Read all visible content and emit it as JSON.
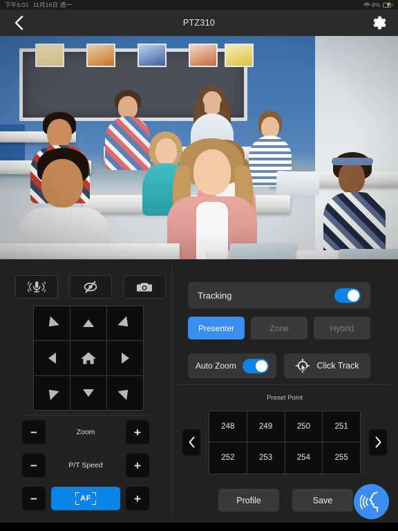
{
  "statusbar": {
    "time": "下午5:01",
    "date": "11月16日 週一",
    "wifi_icon": "wifi-icon",
    "battery_percent": "8%",
    "battery_icon": "battery-charging-icon"
  },
  "navbar": {
    "back_icon": "chevron-left-icon",
    "title": "PTZ310",
    "settings_icon": "gear-icon"
  },
  "video": {
    "alt": "classroom-live-preview"
  },
  "left_controls": {
    "icons": [
      {
        "name": "microphone-icon",
        "label": "Audio"
      },
      {
        "name": "eye-slash-icon",
        "label": "Privacy"
      },
      {
        "name": "camera-icon",
        "label": "Snapshot"
      }
    ],
    "dpad": [
      {
        "name": "pan-up-left",
        "icon": "triangle-up-left-icon"
      },
      {
        "name": "pan-up",
        "icon": "triangle-up-icon"
      },
      {
        "name": "pan-up-right",
        "icon": "triangle-up-right-icon"
      },
      {
        "name": "pan-left",
        "icon": "triangle-left-icon"
      },
      {
        "name": "home",
        "icon": "home-icon"
      },
      {
        "name": "pan-right",
        "icon": "triangle-right-icon"
      },
      {
        "name": "pan-down-left",
        "icon": "triangle-down-left-icon"
      },
      {
        "name": "pan-down",
        "icon": "triangle-down-icon"
      },
      {
        "name": "pan-down-right",
        "icon": "triangle-down-right-icon"
      }
    ],
    "sliders": [
      {
        "minus": "−",
        "label": "Zoom",
        "plus": "+"
      },
      {
        "minus": "−",
        "label": "P/T Speed",
        "plus": "+"
      }
    ],
    "af_row": {
      "minus": "−",
      "label": "AF",
      "plus": "+",
      "icon": "autofocus-icon"
    }
  },
  "right_controls": {
    "tracking": {
      "label": "Tracking",
      "enabled": true
    },
    "modes": [
      {
        "label": "Presenter",
        "active": true
      },
      {
        "label": "Zone",
        "active": false
      },
      {
        "label": "Hybrid",
        "active": false
      }
    ],
    "auto_zoom": {
      "label": "Auto Zoom",
      "enabled": true
    },
    "click_track": {
      "label": "Click Track",
      "icon": "target-cursor-icon"
    },
    "preset": {
      "title": "Preset Point",
      "prev_icon": "chevron-left-icon",
      "next_icon": "chevron-right-icon",
      "points": [
        "248",
        "249",
        "250",
        "251",
        "252",
        "253",
        "254",
        "255"
      ]
    },
    "actions": [
      {
        "label": "Profile"
      },
      {
        "label": "Save"
      }
    ],
    "fab": {
      "icon": "voice-tracking-icon"
    }
  },
  "colors": {
    "accent_blue": "#0b84e8",
    "mode_blue": "#3b8ef0",
    "panel_bg": "#222222",
    "navbar_bg": "#2b2b2b",
    "button_dark": "#0d0d0d",
    "button_grey": "#3a3a3a",
    "battery_red": "#e8443a"
  }
}
